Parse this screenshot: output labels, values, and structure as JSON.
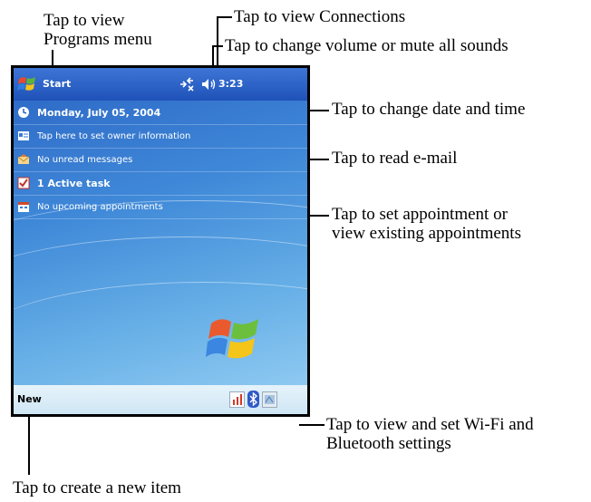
{
  "annotations": {
    "programs_menu_line1": "Tap to view",
    "programs_menu_line2": "Programs menu",
    "connections": "Tap to view Connections",
    "volume": "Tap to change volume or mute all sounds",
    "date_time": "Tap to change date and time",
    "email": "Tap to read e-mail",
    "appointments_line1": "Tap to set appointment or",
    "appointments_line2": "view existing appointments",
    "wifi_line1": "Tap to view and set Wi-Fi and",
    "wifi_line2": "Bluetooth settings",
    "new_item": "Tap to create a new item"
  },
  "device": {
    "start_label": "Start",
    "time": "3:23",
    "date": "Monday, July 05, 2004",
    "owner": "Tap here to set owner information",
    "messages": "No unread messages",
    "tasks": "1 Active task",
    "appointments": "No upcoming appointments",
    "new_label": "New"
  },
  "icons": [
    "windows-flag-icon",
    "connectivity-icon",
    "speaker-icon",
    "clock-icon",
    "owner-card-icon",
    "envelope-icon",
    "task-check-icon",
    "calendar-icon",
    "windows-logo-icon",
    "wifi-icon",
    "bluetooth-icon",
    "settings-icon"
  ],
  "colors": {
    "titlebar": "#2a5fc4",
    "today_background": "#4a90da",
    "bottombar": "#d9ecf8"
  }
}
